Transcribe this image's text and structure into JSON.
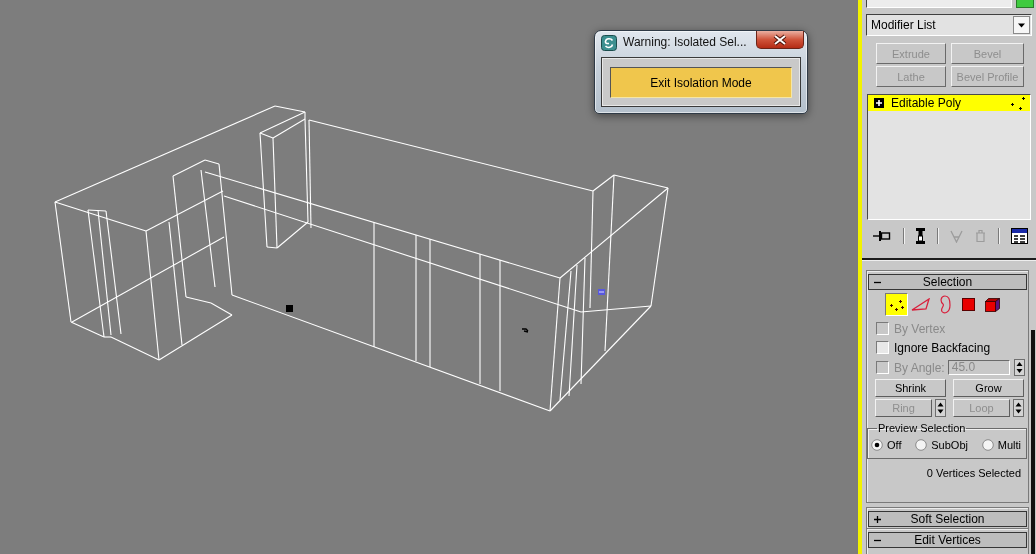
{
  "dialog": {
    "title": "Warning: Isolated Sel...",
    "button": "Exit Isolation Mode"
  },
  "command_panel": {
    "modifier_list": {
      "value": "Modifier List"
    },
    "modifier_buttons": [
      {
        "label": "Extrude",
        "disabled": true
      },
      {
        "label": "Bevel",
        "disabled": true
      },
      {
        "label": "Lathe",
        "disabled": true
      },
      {
        "label": "Bevel Profile",
        "disabled": true
      }
    ],
    "stack": [
      {
        "label": "Editable Poly",
        "selected": true,
        "expanded": false
      }
    ],
    "stack_tools": [
      {
        "kind": "pin",
        "disabled": false
      },
      {
        "kind": "end_result",
        "disabled": false
      },
      {
        "kind": "make_unique",
        "disabled": true
      },
      {
        "kind": "remove",
        "disabled": true
      },
      {
        "kind": "configure",
        "disabled": false
      }
    ],
    "rollouts": [
      {
        "title": "Selection",
        "expanded": true,
        "content": {
          "levels": [
            {
              "kind": "vertex",
              "selected": true
            },
            {
              "kind": "edge",
              "selected": false
            },
            {
              "kind": "border",
              "selected": false
            },
            {
              "kind": "polygon",
              "selected": false
            },
            {
              "kind": "element",
              "selected": false
            }
          ],
          "options": [
            {
              "kind": "checkbox",
              "label": "By Vertex",
              "checked": false,
              "disabled": true
            },
            {
              "kind": "checkbox",
              "label": "Ignore Backfacing",
              "checked": false,
              "disabled": false
            },
            {
              "kind": "angle",
              "label": "By Angle:",
              "checked": false,
              "disabled": true,
              "value": "45.0"
            }
          ],
          "buttons": [
            {
              "kind": "plain",
              "label": "Shrink",
              "disabled": false
            },
            {
              "kind": "plain",
              "label": "Grow",
              "disabled": false
            },
            {
              "kind": "spinner",
              "label": "Ring",
              "disabled": true
            },
            {
              "kind": "spinner",
              "label": "Loop",
              "disabled": true
            }
          ],
          "preview": {
            "title": "Preview Selection",
            "options": [
              {
                "label": "Off",
                "selected": true
              },
              {
                "label": "SubObj",
                "selected": false
              },
              {
                "label": "Multi",
                "selected": false
              }
            ]
          },
          "status": "0 Vertices Selected"
        }
      },
      {
        "title": "Soft Selection",
        "expanded": false
      },
      {
        "title": "Edit Vertices",
        "expanded": true
      }
    ]
  }
}
